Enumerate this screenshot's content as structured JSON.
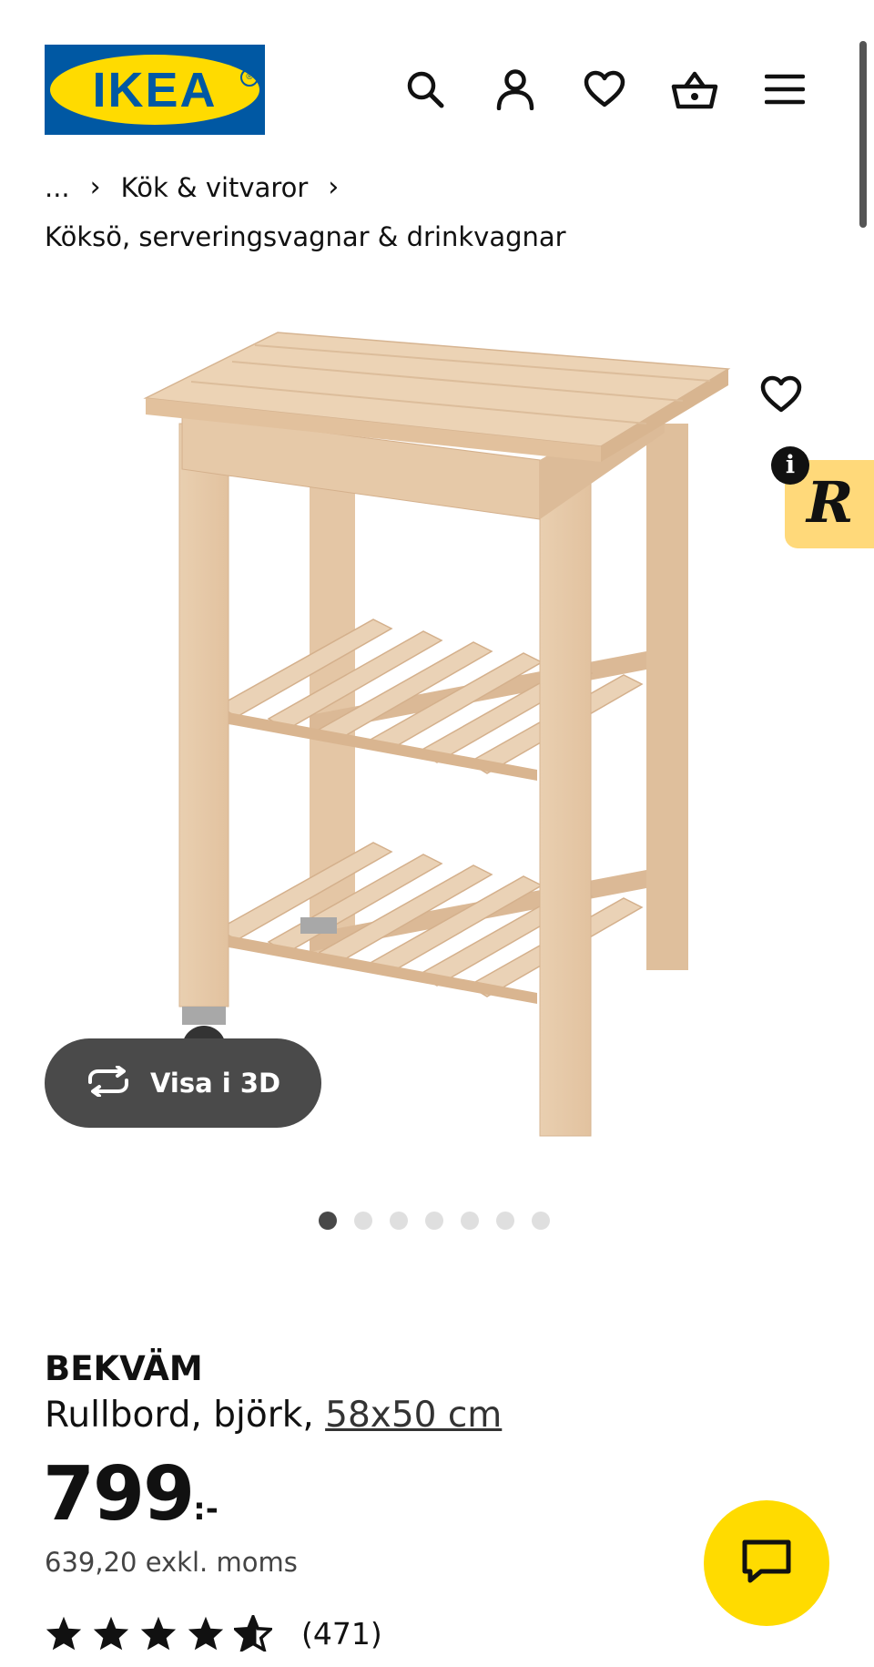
{
  "header": {
    "logo_text": "IKEA",
    "logo_reg": "®",
    "icons": [
      "search-icon",
      "account-icon",
      "favorites-icon",
      "cart-icon",
      "menu-icon"
    ]
  },
  "breadcrumb": {
    "ellipsis": "...",
    "separator": "›",
    "level1": "Kök & vitvaror",
    "level2": "Köksö, serveringsvagnar & drinkvagnar"
  },
  "gallery": {
    "view3d_label": "Visa i 3D",
    "dots_count": 7,
    "active_index": 0,
    "badge_letter": "R",
    "info_letter": "i"
  },
  "product": {
    "name": "BEKVÄM",
    "description": "Rullbord, björk, ",
    "size": "58x50 cm",
    "price": "799",
    "price_suffix": ":-",
    "price_excl": "639,20 exkl. moms",
    "stars": 4.5,
    "review_count": "(471)"
  },
  "colors": {
    "ikea_blue": "#0058a3",
    "ikea_yellow": "#ffdb00",
    "button_dark": "#4a4a4a"
  }
}
